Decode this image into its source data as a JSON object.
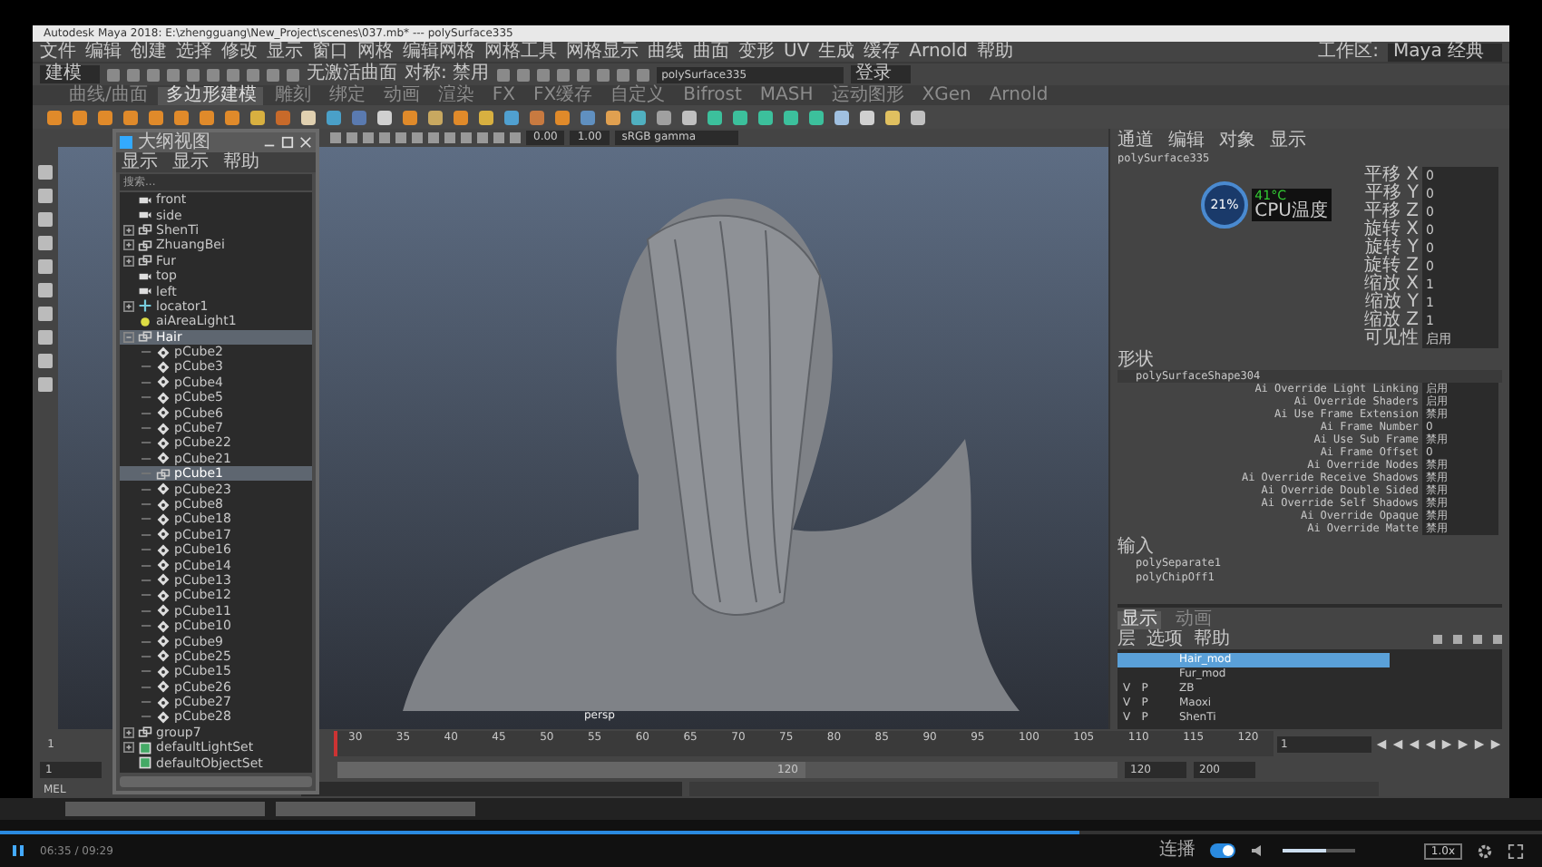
{
  "window": {
    "title": "Autodesk Maya 2018: E:\\zhengguang\\New_Project\\scenes\\037.mb* --- polySurface335"
  },
  "menu_bar": {
    "items": [
      "文件",
      "编辑",
      "创建",
      "选择",
      "修改",
      "显示",
      "窗口",
      "网格",
      "编辑网格",
      "网格工具",
      "网格显示",
      "曲线",
      "曲面",
      "变形",
      "UV",
      "生成",
      "缓存",
      "Arnold",
      "帮助"
    ],
    "workspace_label": "工作区:",
    "workspace": "Maya 经典"
  },
  "status_line": {
    "mode": "建模",
    "surface": "无激活曲面",
    "symmetry": "对称: 禁用",
    "object_field": "polySurface335",
    "account": "登录"
  },
  "shelf_tabs": [
    {
      "label": "曲线/曲面",
      "selected": false
    },
    {
      "label": "多边形建模",
      "selected": true
    },
    {
      "label": "雕刻",
      "selected": false
    },
    {
      "label": "绑定",
      "selected": false
    },
    {
      "label": "动画",
      "selected": false
    },
    {
      "label": "渲染",
      "selected": false
    },
    {
      "label": "FX",
      "selected": false
    },
    {
      "label": "FX缓存",
      "selected": false
    },
    {
      "label": "自定义",
      "selected": false
    },
    {
      "label": "Bifrost",
      "selected": false
    },
    {
      "label": "MASH",
      "selected": false
    },
    {
      "label": "运动图形",
      "selected": false
    },
    {
      "label": "XGen",
      "selected": false
    },
    {
      "label": "Arnold",
      "selected": false
    }
  ],
  "viewport": {
    "toolbar_values": [
      "0.00",
      "1.00"
    ],
    "color_space": "sRGB gamma",
    "camera_label": "persp"
  },
  "outliner": {
    "title": "大纲视图",
    "menu": [
      "显示",
      "显示",
      "帮助"
    ],
    "search": {
      "placeholder": "搜索..."
    },
    "items": [
      {
        "name": "front",
        "kind": "camera",
        "selected": false
      },
      {
        "name": "side",
        "kind": "camera",
        "selected": false
      },
      {
        "name": "ShenTi",
        "kind": "group",
        "selected": false,
        "expanded": false
      },
      {
        "name": "ZhuangBei",
        "kind": "group",
        "selected": false,
        "expanded": false
      },
      {
        "name": "Fur",
        "kind": "group",
        "selected": false,
        "expanded": false
      },
      {
        "name": "top",
        "kind": "camera",
        "selected": false
      },
      {
        "name": "left",
        "kind": "camera",
        "selected": false
      },
      {
        "name": "locator1",
        "kind": "locator",
        "selected": false,
        "expanded": false
      },
      {
        "name": "aiAreaLight1",
        "kind": "light",
        "selected": false
      },
      {
        "name": "Hair",
        "kind": "group",
        "selected": true,
        "expanded": true,
        "children": [
          {
            "name": "pCube2",
            "kind": "mesh",
            "selected": false
          },
          {
            "name": "pCube3",
            "kind": "mesh",
            "selected": false
          },
          {
            "name": "pCube4",
            "kind": "mesh",
            "selected": false
          },
          {
            "name": "pCube5",
            "kind": "mesh",
            "selected": false
          },
          {
            "name": "pCube6",
            "kind": "mesh",
            "selected": false
          },
          {
            "name": "pCube7",
            "kind": "mesh",
            "selected": false
          },
          {
            "name": "pCube22",
            "kind": "mesh",
            "selected": false
          },
          {
            "name": "pCube21",
            "kind": "mesh",
            "selected": false
          },
          {
            "name": "pCube1",
            "kind": "group",
            "selected": true
          },
          {
            "name": "pCube23",
            "kind": "mesh",
            "selected": false
          },
          {
            "name": "pCube8",
            "kind": "mesh",
            "selected": false
          },
          {
            "name": "pCube18",
            "kind": "mesh",
            "selected": false
          },
          {
            "name": "pCube17",
            "kind": "mesh",
            "selected": false
          },
          {
            "name": "pCube16",
            "kind": "mesh",
            "selected": false
          },
          {
            "name": "pCube14",
            "kind": "mesh",
            "selected": false
          },
          {
            "name": "pCube13",
            "kind": "mesh",
            "selected": false
          },
          {
            "name": "pCube12",
            "kind": "mesh",
            "selected": false
          },
          {
            "name": "pCube11",
            "kind": "mesh",
            "selected": false
          },
          {
            "name": "pCube10",
            "kind": "mesh",
            "selected": false
          },
          {
            "name": "pCube9",
            "kind": "mesh",
            "selected": false
          },
          {
            "name": "pCube25",
            "kind": "mesh",
            "selected": false
          },
          {
            "name": "pCube15",
            "kind": "mesh",
            "selected": false
          },
          {
            "name": "pCube26",
            "kind": "mesh",
            "selected": false
          },
          {
            "name": "pCube27",
            "kind": "mesh",
            "selected": false
          },
          {
            "name": "pCube28",
            "kind": "mesh",
            "selected": false
          }
        ]
      },
      {
        "name": "group7",
        "kind": "group",
        "selected": false,
        "expanded": false
      },
      {
        "name": "defaultLightSet",
        "kind": "set",
        "selected": false,
        "expanded": false
      },
      {
        "name": "defaultObjectSet",
        "kind": "set",
        "selected": false
      }
    ]
  },
  "channel_box": {
    "menu": [
      "通道",
      "编辑",
      "对象",
      "显示"
    ],
    "object": "polySurface335",
    "channels": [
      {
        "label": "平移 X",
        "value": "0"
      },
      {
        "label": "平移 Y",
        "value": "0"
      },
      {
        "label": "平移 Z",
        "value": "0"
      },
      {
        "label": "旋转 X",
        "value": "0"
      },
      {
        "label": "旋转 Y",
        "value": "0"
      },
      {
        "label": "旋转 Z",
        "value": "0"
      },
      {
        "label": "缩放 X",
        "value": "1"
      },
      {
        "label": "缩放 Y",
        "value": "1"
      },
      {
        "label": "缩放 Z",
        "value": "1"
      },
      {
        "label": "可见性",
        "value": "启用"
      }
    ],
    "shapes_header": "形状",
    "shape": "polySurfaceShape304",
    "shape_attrs": [
      {
        "label": "Ai Override Light Linking",
        "value": "启用"
      },
      {
        "label": "Ai Override Shaders",
        "value": "启用"
      },
      {
        "label": "Ai Use Frame Extension",
        "value": "禁用"
      },
      {
        "label": "Ai Frame Number",
        "value": "0"
      },
      {
        "label": "Ai Use Sub Frame",
        "value": "禁用"
      },
      {
        "label": "Ai Frame Offset",
        "value": "0"
      },
      {
        "label": "Ai Override Nodes",
        "value": "禁用"
      },
      {
        "label": "Ai Override Receive Shadows",
        "value": "禁用"
      },
      {
        "label": "Ai Override Double Sided",
        "value": "禁用"
      },
      {
        "label": "Ai Override Self Shadows",
        "value": "禁用"
      },
      {
        "label": "Ai Override Opaque",
        "value": "禁用"
      },
      {
        "label": "Ai Override Matte",
        "value": "禁用"
      }
    ],
    "inputs_header": "输入",
    "inputs": [
      "polySeparate1",
      "polyChipOff1"
    ]
  },
  "cpu_monitor": {
    "usage": "21%",
    "temperature": "41°C",
    "label": "CPU温度"
  },
  "layer_editor": {
    "tabs": [
      {
        "label": "显示",
        "selected": true
      },
      {
        "label": "动画",
        "selected": false
      }
    ],
    "menu": [
      "层",
      "选项",
      "帮助"
    ],
    "layers": [
      {
        "name": "Hair_mod",
        "selected": true
      },
      {
        "name": "Fur_mod",
        "selected": false
      },
      {
        "name": "ZB",
        "selected": false,
        "v": "V",
        "p": "P"
      },
      {
        "name": "Maoxi",
        "selected": false,
        "v": "V",
        "p": "P"
      },
      {
        "name": "ShenTi",
        "selected": false,
        "v": "V",
        "p": "P"
      }
    ]
  },
  "time_slider": {
    "start": "1",
    "level": 0,
    "ticks": [
      "30",
      "35",
      "40",
      "45",
      "50",
      "55",
      "60",
      "65",
      "70",
      "75",
      "80",
      "85",
      "90",
      "95",
      "100",
      "105",
      "110",
      "115",
      "120"
    ],
    "current_frame": "1"
  },
  "range_slider": {
    "start": "1",
    "level": 0.6,
    "inner_end": "120",
    "end": "120",
    "anim_end": "200"
  },
  "command_line": {
    "label": "MEL"
  },
  "player": {
    "time": "06:35 / 09:29",
    "progress": {
      "level": 0.7
    },
    "autoplay": {
      "label": "连播",
      "on": true
    },
    "volume": {
      "level": 0.6
    },
    "speed": "1.0x"
  }
}
